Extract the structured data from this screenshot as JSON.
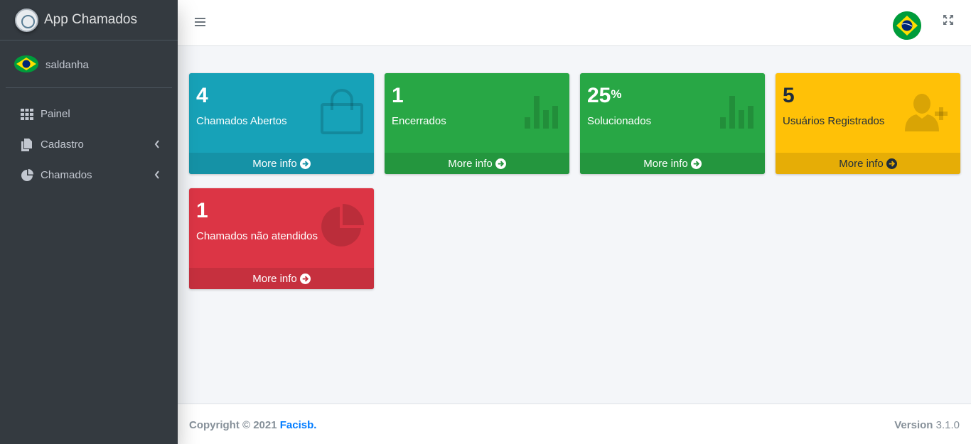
{
  "brand": {
    "title": "App Chamados"
  },
  "user": {
    "name": "saldanha"
  },
  "nav": [
    {
      "label": "Painel",
      "icon": "grid-icon"
    },
    {
      "label": "Cadastro",
      "icon": "copy-icon"
    },
    {
      "label": "Chamados",
      "icon": "pie-chart-icon"
    }
  ],
  "boxes": [
    {
      "value": "4",
      "label": "Chamados Abertos",
      "link": "More info",
      "color": "#17a2b8",
      "icon": "shopping-bag-icon"
    },
    {
      "value": "1",
      "label": "Encerrados",
      "link": "More info",
      "color": "#28a745",
      "icon": "bar-chart-icon"
    },
    {
      "value": "25",
      "suffix": "%",
      "label": "Solucionados",
      "link": "More info",
      "color": "#28a745",
      "icon": "bar-chart-icon"
    },
    {
      "value": "5",
      "label": "Usuários Registrados",
      "link": "More info",
      "color": "#ffc107",
      "icon": "user-plus-icon"
    },
    {
      "value": "1",
      "label": "Chamados não atendidos",
      "link": "More info",
      "color": "#dc3545",
      "icon": "pie-chart-icon"
    }
  ],
  "footer": {
    "copyright_prefix": "Copyright © 2021",
    "company": "Facisb.",
    "version_label": "Version",
    "version": "3.1.0"
  }
}
